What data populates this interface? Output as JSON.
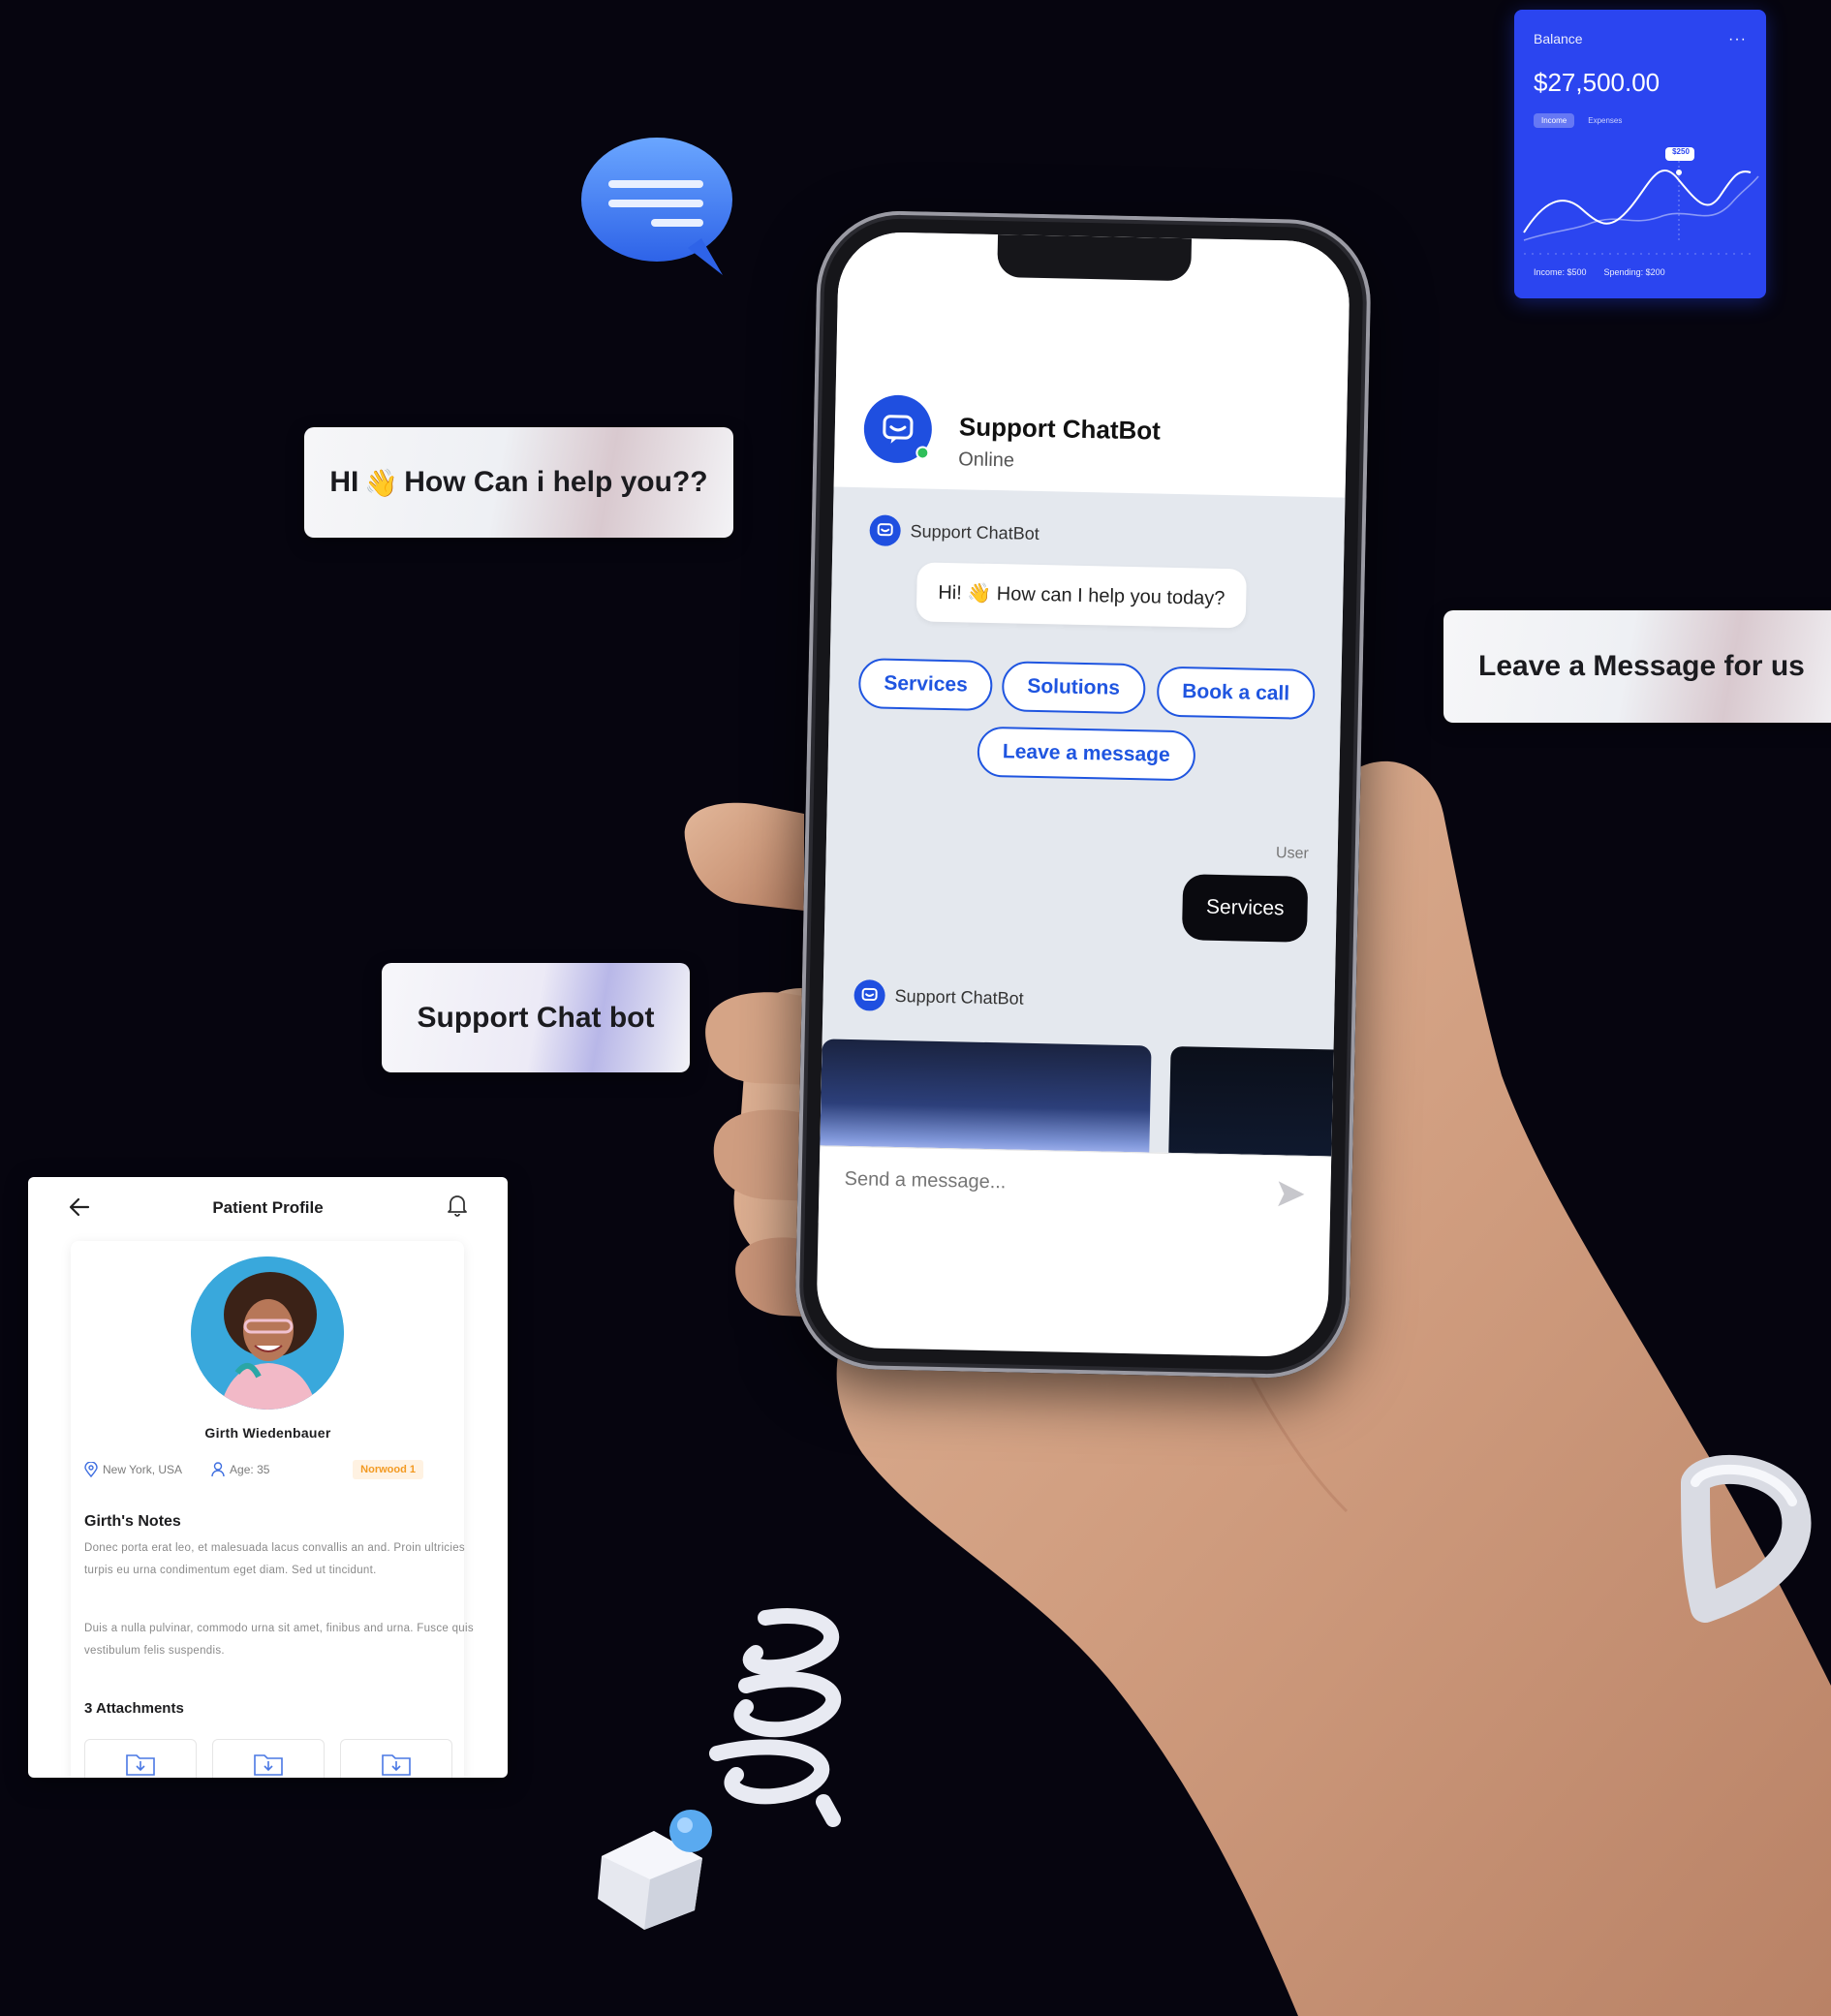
{
  "floating_labels": {
    "greeting_prefix": "HI",
    "greeting_emoji": "👋",
    "greeting_suffix": "How Can i help you??",
    "leave_message": "Leave a Message for us",
    "support_chat_bot": "Support Chat bot"
  },
  "balance_card": {
    "title": "Balance",
    "menu": "···",
    "amount": "$27,500.00",
    "tabs": [
      "Income",
      "Expenses"
    ],
    "tooltip": "$250",
    "income": "Income: $500",
    "spending": "Spending: $200",
    "accent": "#2b45f0"
  },
  "phone": {
    "header": {
      "bot_name": "Support ChatBot",
      "status": "Online"
    },
    "messages": {
      "bot_label_1": "Support ChatBot",
      "greeting": "Hi! 👋 How can I help you today?",
      "options": [
        "Services",
        "Solutions",
        "Book a call",
        "Leave a message"
      ],
      "user_label": "User",
      "user_reply": "Services",
      "bot_label_2": "Support ChatBot"
    },
    "composer": {
      "placeholder": "Send a message..."
    },
    "accent": "#1f55e0"
  },
  "patient_profile": {
    "title": "Patient Profile",
    "name": "Girth Wiedenbauer",
    "location": "New York, USA",
    "age": "Age: 35",
    "tag": "Norwood 1",
    "notes_title": "Girth's Notes",
    "notes_p1": "Donec porta erat leo, et malesuada lacus convallis an and. Proin ultricies turpis eu urna  condimentum  eget diam. Sed ut tincidunt.",
    "notes_p2": "Duis a nulla pulvinar, commodo urna sit amet, finibus and urna. Fusce quis vestibulum felis suspendis.",
    "attachments_title": "3 Attachments",
    "attachment_count": 3
  },
  "icons": [
    "chat-bubble-icon",
    "bot-icon",
    "send-icon",
    "back-arrow-icon",
    "bell-icon",
    "location-pin-icon",
    "person-icon",
    "folder-download-icon"
  ]
}
